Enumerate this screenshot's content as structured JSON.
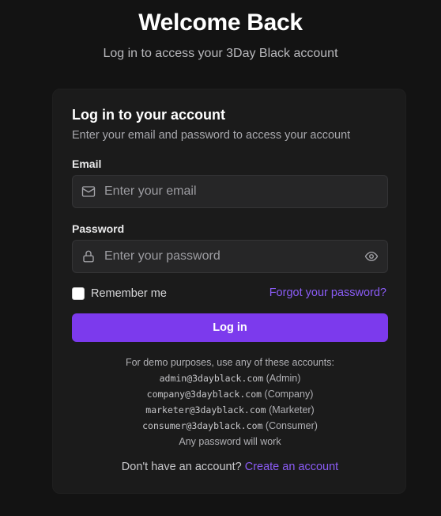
{
  "header": {
    "title": "Welcome Back",
    "subtitle": "Log in to access your 3Day Black account"
  },
  "card": {
    "title": "Log in to your account",
    "description": "Enter your email and password to access your account"
  },
  "form": {
    "email_label": "Email",
    "email_placeholder": "Enter your email",
    "email_value": "",
    "password_label": "Password",
    "password_placeholder": "Enter your password",
    "password_value": "",
    "remember_label": "Remember me",
    "remember_checked": false,
    "forgot_link": "Forgot your password?",
    "submit_label": "Log in"
  },
  "demo": {
    "intro": "For demo purposes, use any of these accounts:",
    "accounts": [
      {
        "email": "admin@3dayblack.com",
        "role": "(Admin)"
      },
      {
        "email": "company@3dayblack.com",
        "role": "(Company)"
      },
      {
        "email": "marketer@3dayblack.com",
        "role": "(Marketer)"
      },
      {
        "email": "consumer@3dayblack.com",
        "role": "(Consumer)"
      }
    ],
    "note": "Any password will work"
  },
  "signup": {
    "prompt": "Don't have an account?",
    "link": "Create an account"
  },
  "icons": {
    "email": "mail-icon",
    "password": "lock-icon",
    "toggle": "eye-icon"
  },
  "colors": {
    "background": "#131313",
    "card": "#1b1b1b",
    "accent": "#7c3aed",
    "link": "#8b5cf6"
  }
}
